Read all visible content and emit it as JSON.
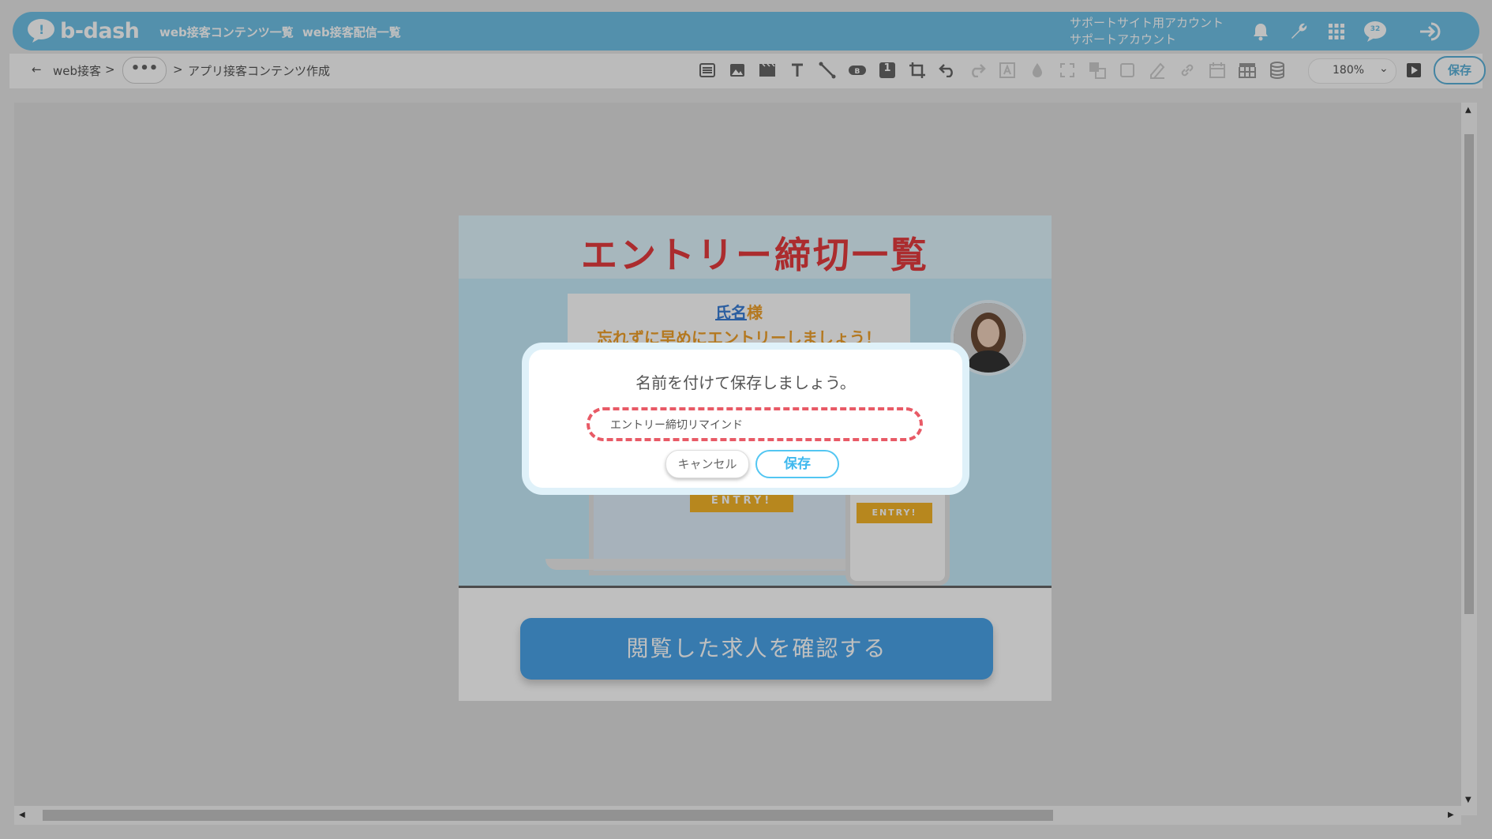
{
  "header": {
    "logo_text": "b-dash",
    "nav": [
      "web接客コンテンツ一覧",
      "web接客配信一覧"
    ],
    "account_line1": "サポートサイト用アカウント",
    "account_line2": "サポートアカウント",
    "notification_badge": "32",
    "icons": [
      "bell-icon",
      "wrench-icon",
      "apps-grid-icon",
      "chat-icon",
      "logout-icon"
    ]
  },
  "breadcrumb": {
    "back": "←",
    "item1": "web接客",
    "sep": ">",
    "more": "•••",
    "current": "アプリ接客コンテンツ作成"
  },
  "toolbar": {
    "zoom": "180%",
    "save_label": "保存",
    "numbered_badge": "1",
    "icons": [
      "list-icon",
      "image-icon",
      "video-icon",
      "text-icon",
      "line-icon",
      "button-icon",
      "number-icon",
      "crop-icon",
      "undo-icon",
      "redo-icon",
      "text-frame-icon",
      "fill-icon",
      "fullscreen-icon",
      "layers-icon",
      "border-icon",
      "pen-icon",
      "link-icon",
      "calendar-icon",
      "table-icon",
      "database-icon",
      "play-icon"
    ]
  },
  "preview": {
    "title": "エントリー締切一覧",
    "name_prefix": "氏名",
    "name_suffix": "様",
    "message": "忘れずに早めにエントリーしましょう！",
    "entry_label": "ENTRY!",
    "cta_label": "閲覧した求人を確認する"
  },
  "modal": {
    "title": "名前を付けて保存しましょう。",
    "input_value": "エントリー締切リマインド",
    "cancel_label": "キャンセル",
    "save_label": "保存"
  },
  "colors": {
    "header_bg": "#6fc0e6",
    "accent": "#53c6f2",
    "title_red": "#e53b3e",
    "cta_blue": "#4aa3e8",
    "entry_orange": "#f4b429",
    "input_dashed": "#e85a66"
  }
}
